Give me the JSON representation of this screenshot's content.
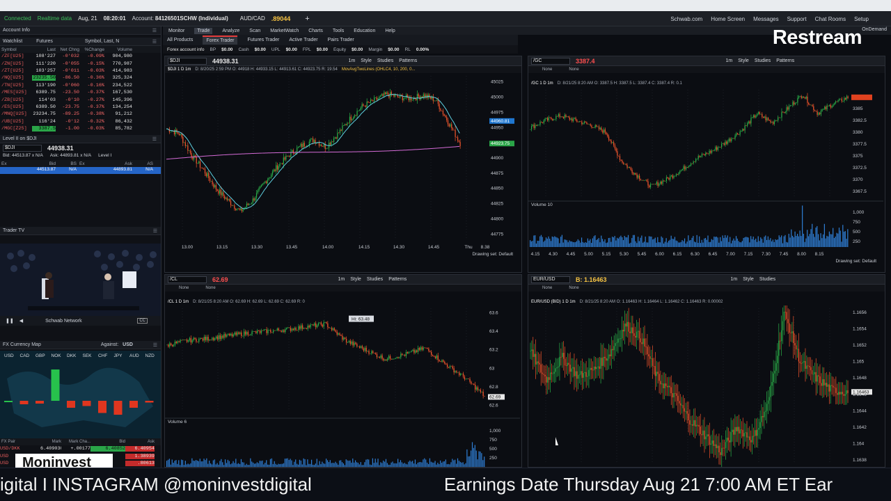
{
  "topbar": {
    "connected": "Connected",
    "realtime": "Realtime data",
    "date": "Aug, 21",
    "time": "08:20:01",
    "account_label": "Account:",
    "account": "84126501SCHW (Individual)",
    "pair": "AUD/CAD",
    "pair_price": ".89044",
    "menu": [
      "Schwab.com",
      "Home Screen",
      "Messages",
      "Support",
      "Chat Rooms",
      "Setup"
    ]
  },
  "brand": {
    "restream": "Restream",
    "ondemand": "OnDemand"
  },
  "left": {
    "account_info": "Account Info",
    "watchlist": {
      "title": "Watchlist",
      "list": "Futures",
      "search": "Symbol, Last, N",
      "headers": [
        "Symbol",
        "Last",
        "Net Chng",
        "%Change",
        "Volume"
      ],
      "rows": [
        [
          "/ZF[U25]",
          "108'227",
          "-0'032",
          "-0.09%",
          "904,980"
        ],
        [
          "/ZN[U25]",
          "111'220",
          "-0'055",
          "-0.15%",
          "770,987"
        ],
        [
          "/ZT[U25]",
          "103'257",
          "-0'011",
          "-0.03%",
          "414,983"
        ],
        [
          "/NQ[U25]",
          "23235.50",
          "-86.50",
          "-0.36%",
          "325,324"
        ],
        [
          "/TN[U25]",
          "113'190",
          "-0'060",
          "-0.16%",
          "234,522"
        ],
        [
          "/MES[U25]",
          "6389.75",
          "-23.50",
          "-0.37%",
          "167,530"
        ],
        [
          "/ZB[U25]",
          "114'03",
          "-0'10",
          "-0.27%",
          "145,396"
        ],
        [
          "/ES[U25]",
          "6389.50",
          "-23.75",
          "-0.37%",
          "134,254"
        ],
        [
          "/MNQ[U25]",
          "23234.75",
          "-89.25",
          "-0.38%",
          "91,212"
        ],
        [
          "/UB[U25]",
          "116'24",
          "-0'12",
          "-0.32%",
          "86,432"
        ],
        [
          "/MGC[Z25]",
          "3387.5",
          "-1.00",
          "-0.03%",
          "85,782"
        ]
      ]
    },
    "level2": {
      "title": "Level II on $DJI",
      "symbol": "$DJI",
      "price": "44938.31",
      "bid": "Bid: 44513.87 x N/A",
      "ask": "Ask: 44893.81 x N/A",
      "level": "Level I",
      "headers": [
        "Ex",
        "Bid",
        "BS",
        "Ex",
        "Ask",
        "AS"
      ],
      "row": [
        "",
        "44513.87",
        "N/A",
        "",
        "44893.81",
        "N/A"
      ]
    },
    "tradertv": {
      "title": "Trader TV",
      "channel": "Schwab Network"
    },
    "fxmap": {
      "title": "FX Currency Map",
      "against_label": "Against:",
      "against": "USD",
      "currencies": [
        "USD",
        "CAD",
        "GBP",
        "NOK",
        "DKK",
        "SEK",
        "CHF",
        "JPY",
        "AUD",
        "NZD"
      ],
      "levels": [
        0,
        -0.1,
        -0.08,
        0.9,
        -0.2,
        -0.15,
        -0.35,
        -0.4,
        -0.2,
        -0.05
      ],
      "table_headers": [
        "FX Pair",
        "Mark",
        "Mark Cha...",
        "Bid",
        "Ask"
      ],
      "table_rows": [
        [
          "USD/DKK",
          "6.409030",
          "+.00177",
          "6.40852",
          "6.40954"
        ],
        [
          "USD",
          "",
          "",
          "",
          "1.38939"
        ],
        [
          "USD",
          "",
          "",
          "",
          ".80613"
        ],
        [
          "AUD",
          "",
          "",
          "",
          ".64261"
        ]
      ]
    },
    "moninvest": "Moninvest"
  },
  "menubar": {
    "items": [
      "Monitor",
      "Trade",
      "Analyze",
      "Scan",
      "MarketWatch",
      "Charts",
      "Tools",
      "Education",
      "Help"
    ],
    "active": "Trade"
  },
  "subbar": {
    "items": [
      "All Products",
      "Forex Trader",
      "Futures Trader",
      "Active Trader",
      "Pairs Trader"
    ],
    "active": "Forex Trader"
  },
  "acctbar": {
    "title": "Forex account info",
    "items": [
      [
        "BP",
        "$0.00"
      ],
      [
        "Cash",
        "$0.00"
      ],
      [
        "UPL",
        "$0.00"
      ],
      [
        "FPL",
        "$0.00"
      ],
      [
        "Equity",
        "$0.00"
      ],
      [
        "Margin",
        "$0.00"
      ],
      [
        "RL",
        "0.00%"
      ]
    ]
  },
  "charts": {
    "dji": {
      "symbol": "$DJI",
      "price": "44938.31",
      "title": "$DJI 1 D 1m",
      "info": "D: 8/20/25 2:59 PM  O: 44918  H: 44933.15  L: 44913.61  C: 44923.75  R: 19.54",
      "study": "MovAvgTwoLines (OHLC4, 10, 200, 0...",
      "yticks": [
        "45025",
        "45000",
        "44975",
        "44950",
        "44925",
        "44900",
        "44875",
        "44850",
        "44825",
        "44800",
        "44775"
      ],
      "xticks": [
        "13.00",
        "13.15",
        "13.30",
        "13.45",
        "14.00",
        "14.15",
        "14.30",
        "14.45",
        "Thu",
        "8.38"
      ],
      "last": "44923.75",
      "ma": "44960.81",
      "drawing": "Drawing set: Default"
    },
    "gc": {
      "symbol": "/GC",
      "price": "3387.4",
      "title": "/GC 1 D 1m",
      "info": "D: 8/21/25 8:20 AM  O: 3387.5  H: 3387.5  L: 3387.4  C: 3387.4  R: 0.1",
      "yticks": [
        "3387.4",
        "3385",
        "3382.5",
        "3380",
        "3377.5",
        "3375",
        "3372.5",
        "3370",
        "3367.5"
      ],
      "vol_label": "Volume",
      "vol_value": "10",
      "vol_ticks": [
        "1,000",
        "750",
        "500",
        "250"
      ],
      "xticks": [
        "4.15",
        "4.30",
        "4.45",
        "5.00",
        "5.15",
        "5.30",
        "5.45",
        "6.00",
        "6.15",
        "6.30",
        "6.45",
        "7.00",
        "7.15",
        "7.30",
        "7.45",
        "8.00",
        "8.15"
      ],
      "drawing": "Drawing set: Default"
    },
    "cl": {
      "symbol": "/CL",
      "price": "62.69",
      "title": "/CL 1 D 1m",
      "info": "D: 8/21/25 8:20 AM  O: 62.69  H: 62.69  L: 62.69  C: 62.69  R: 0",
      "hi": "Hi: 63.48",
      "yticks": [
        "63.6",
        "63.4",
        "63.2",
        "63",
        "62.8",
        "62.6"
      ],
      "last": "62.69",
      "vol_label": "Volume",
      "vol_value": "6",
      "vol_ticks": [
        "1,000",
        "750",
        "500",
        "250"
      ]
    },
    "eur": {
      "symbol": "EUR/USD",
      "bid": "B: 1.16463",
      "title": "EUR/USD (BID) 1 D 1m",
      "info": "D: 8/21/25 8:20 AM  O: 1.16463  H: 1.16464  L: 1.16462  C: 1.16463  R: 0.00002",
      "yticks": [
        "1.1656",
        "1.1654",
        "1.1652",
        "1.165",
        "1.1648",
        "1.1646",
        "1.1644",
        "1.1642",
        "1.164",
        "1.1638"
      ],
      "last": "1.16463"
    },
    "toolbar": {
      "style": "Style",
      "studies": "Studies",
      "patterns": "Patterns",
      "tf": "1m",
      "none": "None"
    }
  },
  "ticker": {
    "left": "igital  I  INSTAGRAM @moninvestdigital",
    "right": "Earnings Date Thursday Aug 21 7:00 AM ET Ear"
  }
}
